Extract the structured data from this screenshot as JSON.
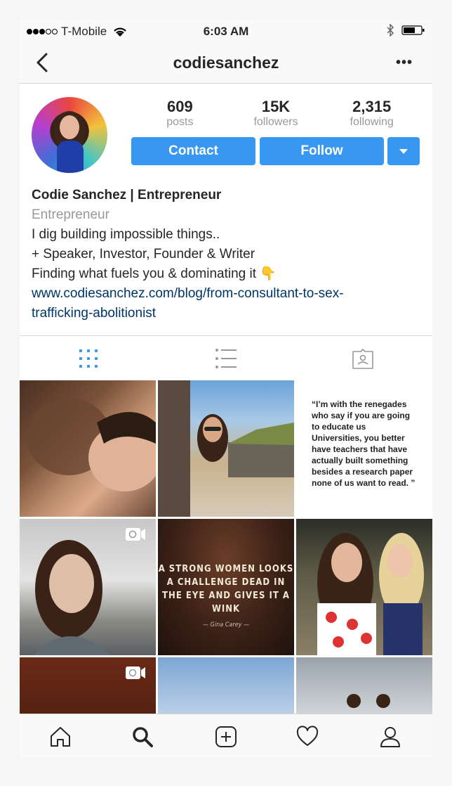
{
  "status_bar": {
    "carrier": "T-Mobile",
    "time": "6:03 AM"
  },
  "nav": {
    "username": "codiesanchez",
    "more_label": "•••"
  },
  "stats": [
    {
      "value": "609",
      "label": "posts"
    },
    {
      "value": "15K",
      "label": "followers"
    },
    {
      "value": "2,315",
      "label": "following"
    }
  ],
  "buttons": {
    "contact": "Contact",
    "follow": "Follow"
  },
  "bio": {
    "name": "Codie Sanchez | Entrepreneur",
    "category": "Entrepreneur",
    "line1": "I dig building impossible things..",
    "line2": "+ Speaker, Investor, Founder & Writer",
    "line3": "Finding what fuels you & dominating it",
    "emoji": "👇",
    "link_part1": "www.codiesanchez.com/blog/from-consultant-to-sex-",
    "link_part2": "trafficking-abolitionist"
  },
  "posts": {
    "quote_text": "“I’m with the renegades who say if you are going to educate us Universities, you better have teachers that have actually built something besides a research paper none of us want to read. ”",
    "poster_text": "A STRONG WOMEN LOOKS A CHALLENGE DEAD IN THE EYE AND GIVES IT A WINK",
    "poster_sub": "— Gina Carey —"
  },
  "colors": {
    "accent": "#3897f0",
    "link": "#003569",
    "muted": "#999999"
  },
  "icons": [
    "back-icon",
    "more-icon",
    "wifi-icon",
    "bluetooth-icon",
    "battery-icon",
    "grid-icon",
    "list-icon",
    "tagged-icon",
    "video-icon",
    "home-icon",
    "search-icon",
    "add-icon",
    "heart-icon",
    "profile-icon"
  ]
}
